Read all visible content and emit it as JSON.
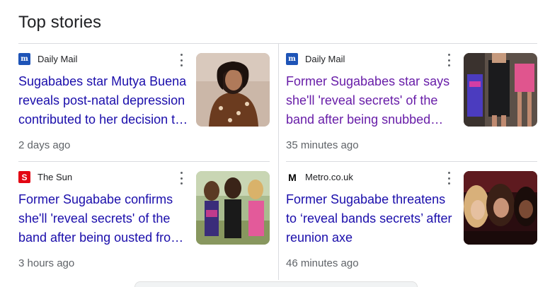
{
  "section": {
    "title": "Top stories"
  },
  "stories": [
    {
      "source": "Daily Mail",
      "favicon": "daily-mail-icon",
      "headline_lines": [
        "Sugababes star Mutya Buena",
        "reveals post-natal depression",
        "contributed to her decision t…"
      ],
      "age": "2 days ago",
      "visited": false
    },
    {
      "source": "Daily Mail",
      "favicon": "daily-mail-icon",
      "headline_lines": [
        "Former Sugababes star says",
        "she'll 'reveal secrets' of the",
        "band after being snubbed…"
      ],
      "age": "35 minutes ago",
      "visited": true
    },
    {
      "source": "The Sun",
      "favicon": "the-sun-icon",
      "headline_lines": [
        "Former Sugababe confirms",
        "she'll 'reveal secrets' of the",
        "band after being ousted fro…"
      ],
      "age": "3 hours ago",
      "visited": false
    },
    {
      "source": "Metro.co.uk",
      "favicon": "metro-icon",
      "headline_lines": [
        "Former Sugababe threatens",
        "to ‘reveal bands secrets’ after",
        "reunion axe"
      ],
      "age": "46 minutes ago",
      "visited": false
    }
  ],
  "colors": {
    "link": "#1a0dab",
    "visited": "#681da8",
    "meta": "#5f6368",
    "divider": "#dadce0"
  }
}
